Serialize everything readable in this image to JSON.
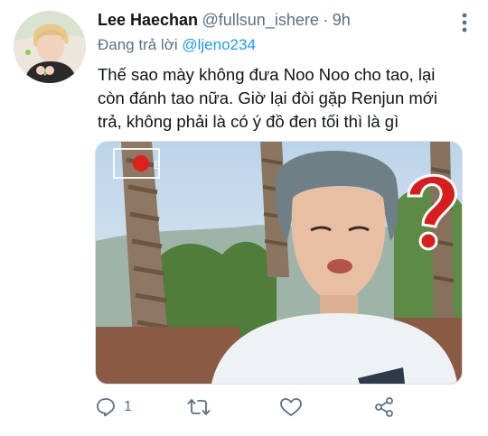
{
  "tweet": {
    "author_name": "Lee Haechan",
    "handle": "@fullsun_ishere",
    "separator": "·",
    "time": "9h",
    "reply_prefix": "Đang trả lời",
    "reply_to": "@ljeno234",
    "text_lines": [
      "Thế sao mày không đưa Noo Noo cho tao, lại",
      "còn đánh tao nữa. Giờ lại đòi gặp Renjun mới",
      "trả, không phải là có ý đồ đen tối thì là gì"
    ],
    "media_overlay_text": "E",
    "actions": {
      "reply_count": "1",
      "retweet_count": "",
      "like_count": ""
    }
  },
  "colors": {
    "text": "#0f1419",
    "secondary": "#5b7083",
    "link": "#1d9bf0",
    "record_dot": "#e0201c",
    "question_mark": "#d91c1c"
  },
  "icons": [
    "more-icon",
    "reply-icon",
    "retweet-icon",
    "like-icon",
    "share-icon"
  ]
}
